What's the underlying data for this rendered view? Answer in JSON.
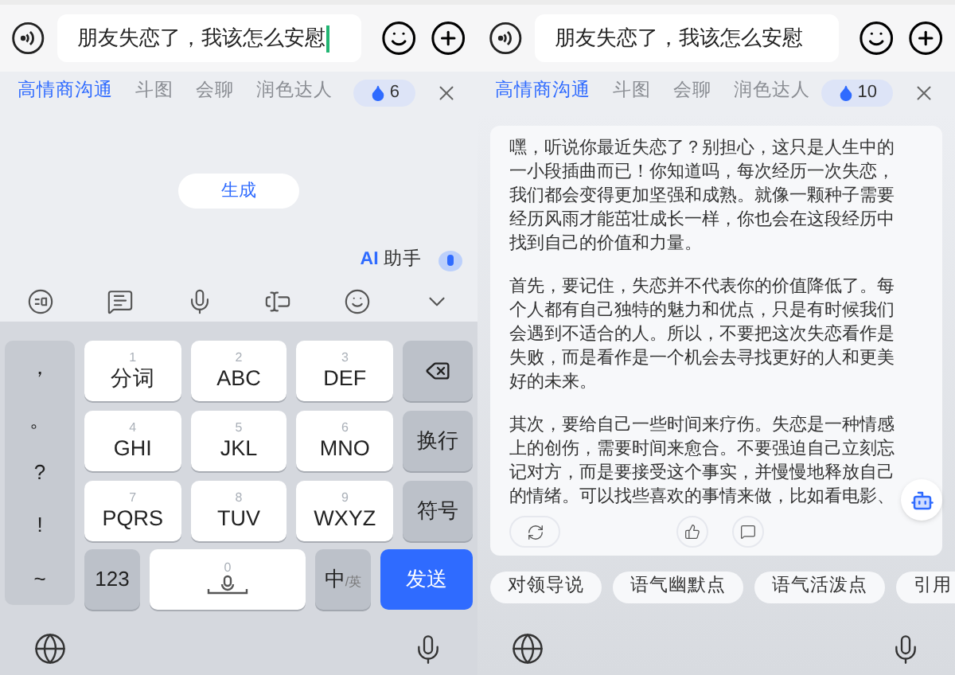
{
  "screens": [
    {
      "kind": "keyboard",
      "input": {
        "value": "朋友失恋了，我该怎么安慰",
        "focused": true
      },
      "tabs": [
        {
          "label": "高情商沟通",
          "selected": true
        },
        {
          "label": "斗图",
          "selected": false
        },
        {
          "label": "会聊",
          "selected": false
        },
        {
          "label": "润色达人",
          "selected": false
        }
      ],
      "credits": "6",
      "generate_button": "生成",
      "assistant": {
        "ai": "AI",
        "label": "助手"
      },
      "punctuation": [
        "，",
        "。",
        "?",
        "!",
        "~"
      ],
      "keys": [
        {
          "number": "1",
          "label": "分词"
        },
        {
          "number": "2",
          "label": "ABC"
        },
        {
          "number": "3",
          "label": "DEF"
        },
        {
          "number": "4",
          "label": "GHI"
        },
        {
          "number": "5",
          "label": "JKL"
        },
        {
          "number": "6",
          "label": "MNO"
        },
        {
          "number": "7",
          "label": "PQRS"
        },
        {
          "number": "8",
          "label": "TUV"
        },
        {
          "number": "9",
          "label": "WXYZ"
        }
      ],
      "side_keys": [
        "换行",
        "符号"
      ],
      "numbers_key": "123",
      "space_number": "0",
      "language_key": {
        "main": "中",
        "alt": "/英"
      },
      "send_key": "发送"
    },
    {
      "kind": "response",
      "input": {
        "value": "朋友失恋了，我该怎么安慰",
        "focused": false
      },
      "tabs": [
        {
          "label": "高情商沟通",
          "selected": true
        },
        {
          "label": "斗图",
          "selected": false
        },
        {
          "label": "会聊",
          "selected": false
        },
        {
          "label": "润色达人",
          "selected": false
        }
      ],
      "credits": "10",
      "paragraphs": [
        "嘿，听说你最近失恋了？别担心，这只是人生中的一小段插曲而已！你知道吗，每次经历一次失恋，我们都会变得更加坚强和成熟。就像一颗种子需要经历风雨才能茁壮成长一样，你也会在这段经历中找到自己的价值和力量。",
        "首先，要记住，失恋并不代表你的价值降低了。每个人都有自己独特的魅力和优点，只是有时候我们会遇到不适合的人。所以，不要把这次失恋看作是失败，而是看作是一个机会去寻找更好的人和更美好的未来。",
        "其次，要给自己一些时间来疗伤。失恋是一种情感上的创伤，需要时间来愈合。不要强迫自己立刻忘记对方，而是要接受这个事实，并慢慢地释放自己的情绪。可以找些喜欢的事情来做，比如看电影、"
      ],
      "chips": [
        "对领导说",
        "语气幽默点",
        "语气活泼点",
        "引用"
      ]
    }
  ]
}
